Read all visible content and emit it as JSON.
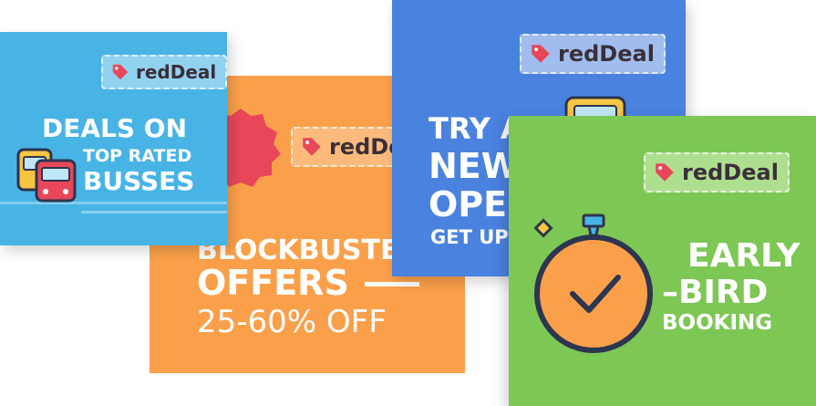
{
  "brand": {
    "logo_text": "redDeal"
  },
  "cards": {
    "blue": {
      "line1": "DEALS ON",
      "line2": "TOP RATED",
      "line3": "BUSSES"
    },
    "orange": {
      "line1": "BLOCKBUSTER",
      "line2": "OFFERS",
      "line3": "25-60% OFF"
    },
    "navy": {
      "line1": "TRY A",
      "line2": "NEW",
      "line3": "OPE",
      "line4": "GET UP"
    },
    "green": {
      "line1": "EARLY",
      "line2": "–BIRD",
      "line3": "BOOKING"
    }
  },
  "colors": {
    "blue_card": "#48b4e6",
    "orange_card": "#fba04a",
    "navy_card": "#4a82e0",
    "green_card": "#7dc754",
    "tag_red": "#e8475a"
  },
  "icons": [
    "tag-icon",
    "bus-icon",
    "badge-icon",
    "stopwatch-icon",
    "checkmark-icon"
  ]
}
